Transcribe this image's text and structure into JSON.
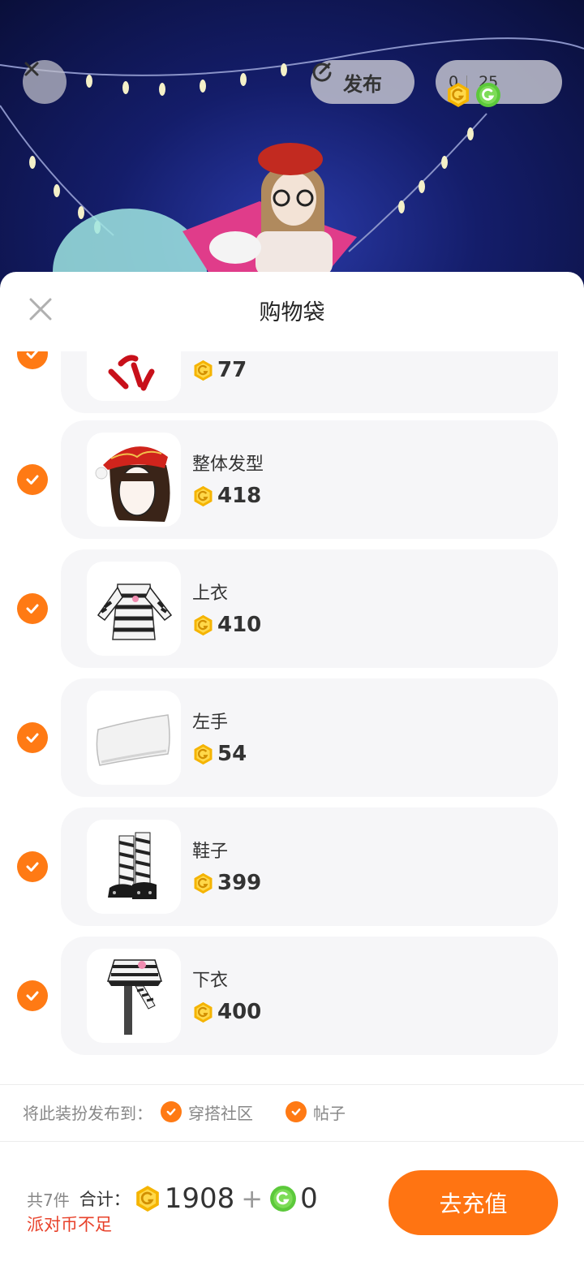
{
  "header": {
    "publish_label": "发布",
    "party_coin_balance": "0",
    "g_coin_balance": "25"
  },
  "sheet": {
    "title": "购物袋",
    "items": [
      {
        "name": "",
        "price": "77"
      },
      {
        "name": "整体发型",
        "price": "418"
      },
      {
        "name": "上衣",
        "price": "410"
      },
      {
        "name": "左手",
        "price": "54"
      },
      {
        "name": "鞋子",
        "price": "399"
      },
      {
        "name": "下衣",
        "price": "400"
      }
    ],
    "publish_to_label": "将此装扮发布到：",
    "publish_targets": [
      "穿搭社区",
      "帖子"
    ]
  },
  "footer": {
    "count_label": "共7件",
    "total_label": "合计：",
    "party_coin_total": "1908",
    "plus_sign": "+",
    "g_coin_total": "0",
    "warning": "派对币不足",
    "recharge_button": "去充值"
  },
  "colors": {
    "accent": "#ff7a14",
    "warning": "#e8412a",
    "party_coin": "#f5b400",
    "g_coin": "#5cc93b"
  }
}
